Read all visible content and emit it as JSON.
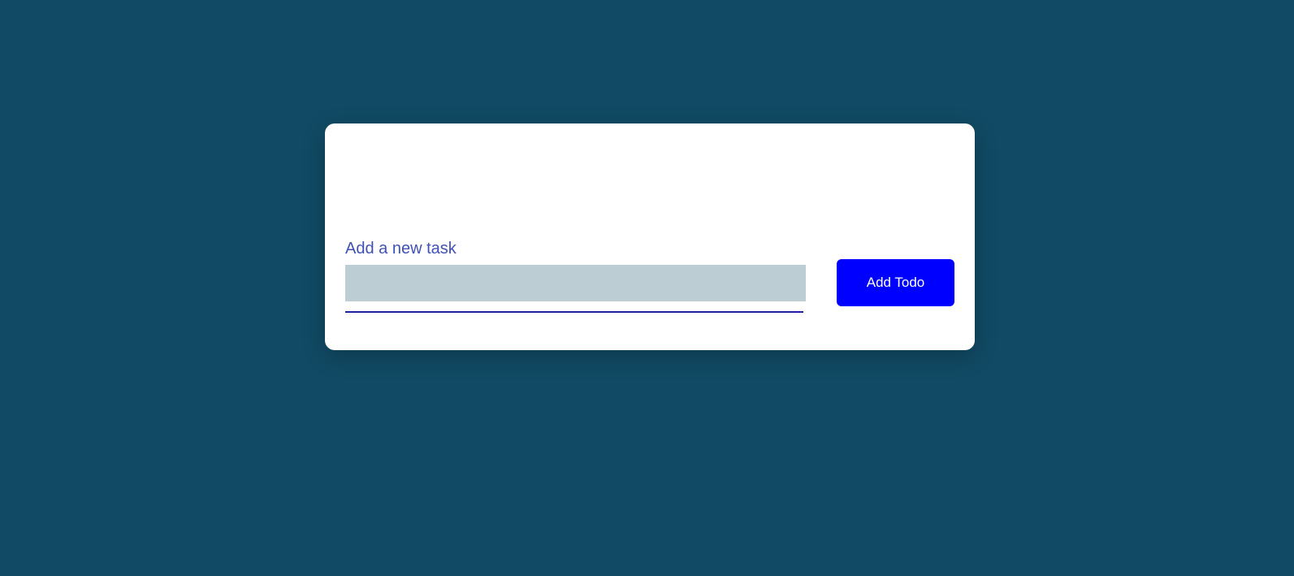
{
  "form": {
    "label": "Add a new task",
    "input_value": "",
    "input_placeholder": "",
    "button_label": "Add Todo"
  },
  "colors": {
    "background": "#114a64",
    "card": "#ffffff",
    "label": "#3f51b5",
    "input_background": "#bccdd4",
    "underline": "#1f1fa8",
    "button": "#0000ff",
    "button_text": "#ffffff"
  }
}
